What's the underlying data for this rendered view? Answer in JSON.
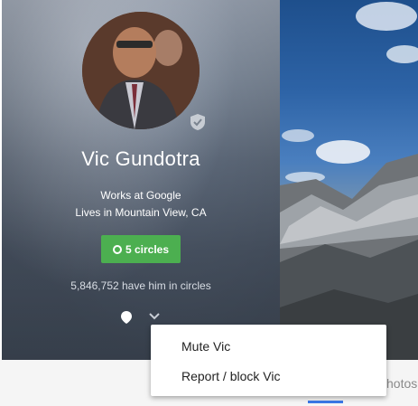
{
  "profile": {
    "name": "Vic Gundotra",
    "works_at": "Works at Google",
    "lives_in": "Lives in Mountain View, CA",
    "circles_button_label": "5 circles",
    "in_circles_count": "5,846,752 have him in circles"
  },
  "menu": {
    "items": [
      {
        "label": "Mute Vic"
      },
      {
        "label": "Report / block Vic"
      }
    ]
  },
  "tabs": {
    "photos_partial": "hotos"
  },
  "colors": {
    "accent_green": "#4caf50",
    "tab_indicator": "#3b78e7"
  },
  "icons": {
    "verified": "verified-shield-icon",
    "location": "location-pin-icon",
    "dropdown": "chevron-down-icon"
  }
}
